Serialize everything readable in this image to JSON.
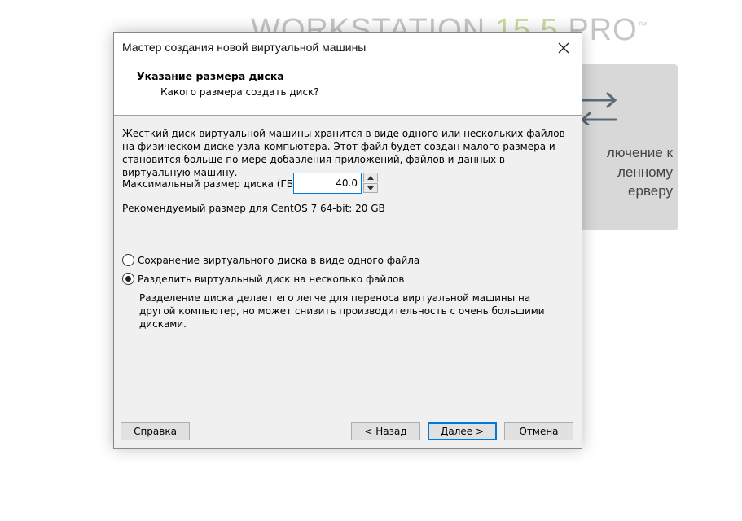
{
  "background": {
    "title_prefix": "WORKSTATION ",
    "title_version": "15.5",
    "title_suffix": " PRO",
    "trademark": "™",
    "card_lines": [
      "лючение к",
      "ленному",
      "ерверу"
    ],
    "card_icon": "swap-arrows-icon"
  },
  "dialog": {
    "window_title": "Мастер создания новой виртуальной машины",
    "close_icon": "close-icon",
    "header_title": "Указание размера диска",
    "header_subtitle": "Какого размера создать диск?",
    "description": "Жесткий диск виртуальной машины хранится в виде одного или нескольких файлов на физическом диске узла-компьютера. Этот файл будет создан малого размера и становится больше по мере добавления приложений, файлов и данных в виртуальную машину.",
    "max_size_label": "Максимальный размер диска (ГБ):",
    "max_size_value": "40.0",
    "recommended": "Рекомендуемый размер для CentOS 7 64-bit: 20 GB",
    "radio_single": "Сохранение виртуального диска в виде одного файла",
    "radio_split": "Разделить виртуальный диск на несколько файлов",
    "selected_option": "split",
    "split_note": "Разделение диска делает его легче для переноса виртуальной машины на другой компьютер, но может снизить производительность с очень большими дисками.",
    "buttons": {
      "help": "Справка",
      "back": "< Назад",
      "next": "Далее >",
      "cancel": "Отмена"
    },
    "accent_color": "#0078d7"
  }
}
